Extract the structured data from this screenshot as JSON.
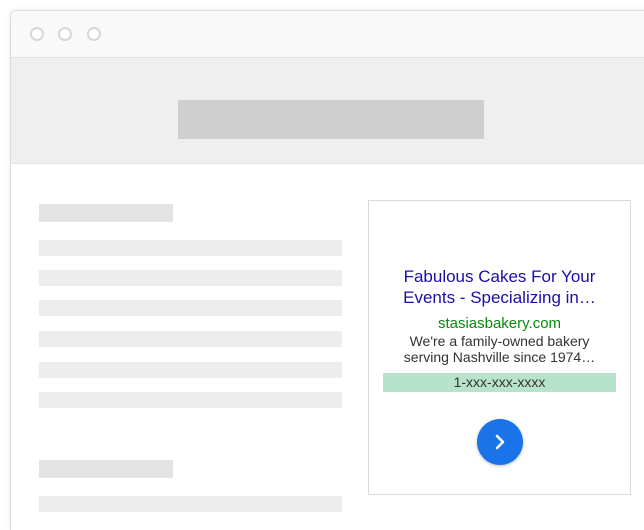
{
  "ad": {
    "title_line1": "Fabulous Cakes For Your",
    "title_line2": "Events - Specializing in…",
    "display_url": "stasiasbakery.com",
    "description_line1": "We're a family-owned bakery",
    "description_line2": "serving Nashville since 1974…",
    "phone": "1-xxx-xxx-xxxx",
    "button_icon": "chevron-right-icon"
  },
  "colors": {
    "title": "#1a0dab",
    "url": "#0a8a10",
    "phone_highlight": "#b7e2cb",
    "button": "#1a73e8"
  }
}
